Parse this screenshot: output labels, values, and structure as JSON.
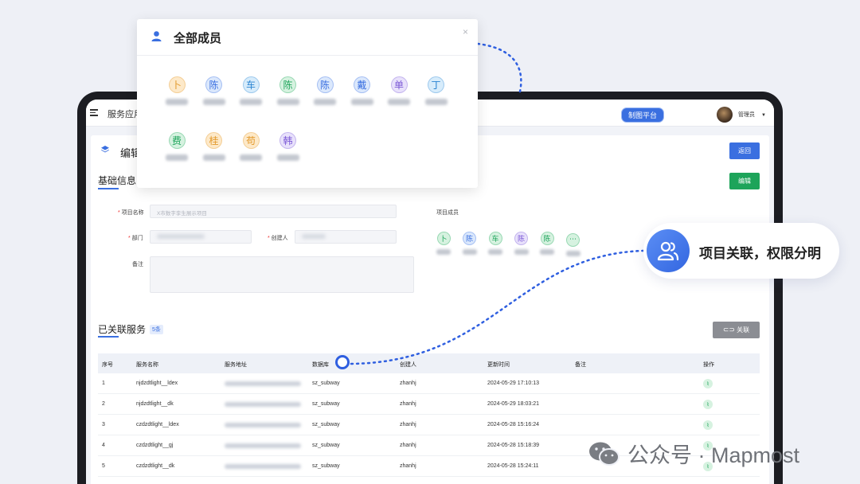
{
  "app": {
    "title": "服务应用",
    "platform_badge": "制图平台",
    "admin_label": "管理员"
  },
  "page": {
    "title": "编辑",
    "back_label": "返回",
    "edit_label": "编辑"
  },
  "basic_info": {
    "title": "基础信息",
    "project_name_label": "项目名称",
    "project_name_value": "X市数字孪生展示项目",
    "department_label": "部门",
    "creator_label": "创建人",
    "remark_label": "备注",
    "members_label": "项目成员",
    "members": [
      "卜",
      "陈",
      "车",
      "陈",
      "陈",
      "⋯"
    ]
  },
  "services": {
    "title": "已关联服务",
    "count": "5条",
    "link_label": "关联",
    "columns": [
      "序号",
      "服务名称",
      "服务地址",
      "数据库",
      "创建人",
      "更新时间",
      "备注",
      "操作"
    ],
    "rows": [
      {
        "idx": "1",
        "name": "njdzdtlight__ldex",
        "db": "sz_subway",
        "creator": "zhanhj",
        "time": "2024-05-29 17:10:13"
      },
      {
        "idx": "2",
        "name": "njdzdtlight__dk",
        "db": "sz_subway",
        "creator": "zhanhj",
        "time": "2024-05-29 18:03:21"
      },
      {
        "idx": "3",
        "name": "czdzdtlight__ldex",
        "db": "sz_subway",
        "creator": "zhanhj",
        "time": "2024-05-28 15:16:24"
      },
      {
        "idx": "4",
        "name": "czdzdtlight__gj",
        "db": "sz_subway",
        "creator": "zhanhj",
        "time": "2024-05-28 15:18:39"
      },
      {
        "idx": "5",
        "name": "czdzdtlight__dk",
        "db": "sz_subway",
        "creator": "zhanhj",
        "time": "2024-05-28 15:24:11"
      }
    ]
  },
  "popup": {
    "title": "全部成员",
    "close": "×",
    "members": [
      "卜",
      "陈",
      "车",
      "陈",
      "陈",
      "戴",
      "单",
      "丁",
      "费",
      "桂",
      "苟",
      "韩"
    ]
  },
  "callout": {
    "text": "项目关联，权限分明"
  },
  "watermark": {
    "text": "公众号 · Mapmost"
  },
  "colors": {
    "accent": "#3a6fe0",
    "success": "#1da45a"
  }
}
